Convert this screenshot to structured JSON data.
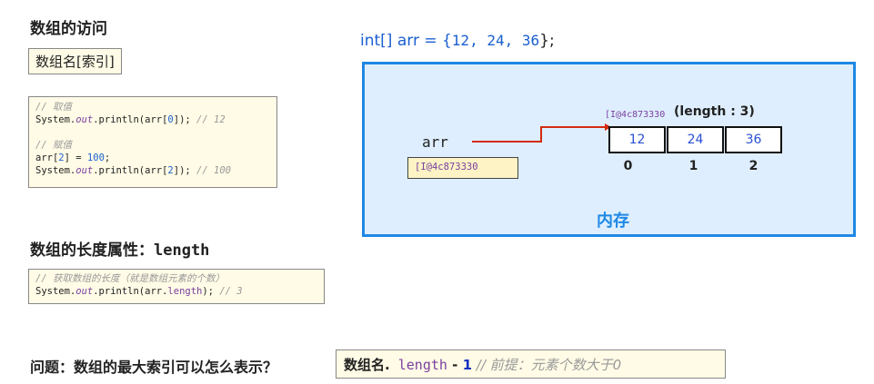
{
  "left": {
    "title": "数组的访问",
    "syntax": "数组名[索引]",
    "code1": {
      "c1": "// 取值",
      "l2a": "System.",
      "l2b": "out",
      "l2c": ".println(arr[",
      "l2d": "0",
      "l2e": "]); ",
      "l2f": "// 12",
      "c2": "// 赋值",
      "l4a": "arr[",
      "l4b": "2",
      "l4c": "] = ",
      "l4d": "100",
      "l4e": ";",
      "l5a": "System.",
      "l5b": "out",
      "l5c": ".println(arr[",
      "l5d": "2",
      "l5e": "]); ",
      "l5f": "// 100"
    },
    "length_title": "数组的长度属性：",
    "length_kw": "length",
    "code2": {
      "c1": "// 获取数组的长度（就是数组元素的个数）",
      "a": "System.",
      "b": "out",
      "c": ".println(arr.",
      "d": "length",
      "e": "); ",
      "f": "// 3"
    },
    "question": "问题：数组的最大索引可以怎么表示？",
    "answer": {
      "a": "数组名.",
      "b": " length",
      "c": " - ",
      "d": "1",
      "e": " // 前提：元素个数大于0"
    }
  },
  "diagram": {
    "decl": {
      "a": "int[] arr = {",
      "b": "12, 24, 36",
      "c": "};"
    },
    "var_name": "arr",
    "var_value": "[I@4c873330",
    "array_addr": "[I@4c873330",
    "array_length": "(length : 3)",
    "cells": [
      "12",
      "24",
      "36"
    ],
    "indices": [
      "0",
      "1",
      "2"
    ],
    "memory_label": "内存"
  }
}
